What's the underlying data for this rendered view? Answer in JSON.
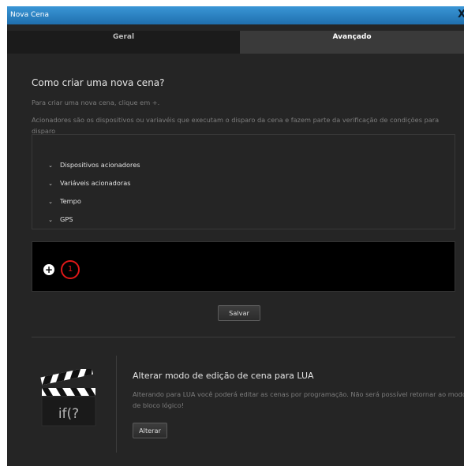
{
  "window": {
    "title": "Nova Cena",
    "close_label": "X"
  },
  "tabs": [
    {
      "label": "Geral",
      "active": false
    },
    {
      "label": "Avançado",
      "active": true
    }
  ],
  "intro": {
    "heading": "Como criar uma nova cena?",
    "line1": "Para criar uma nova cena, clique em +.",
    "line2": "Acionadores são os dispositivos ou variavéis que executam o disparo da cena e fazem parte da verificação de condições para disparo"
  },
  "triggers": [
    {
      "label": "Dispositivos acionadores"
    },
    {
      "label": "Variáveis acionadoras"
    },
    {
      "label": "Tempo"
    },
    {
      "label": "GPS"
    }
  ],
  "editor": {
    "add_symbol": "+",
    "badge_number": "1"
  },
  "save_button": "Salvar",
  "lua": {
    "heading": "Alterar modo de edição de cena para LUA",
    "description": "Alterando para LUA você poderá editar as cenas por programação. Não será possível retornar ao modo de bloco lógico!",
    "button": "Alterar",
    "icon_text": "if(?"
  },
  "colors": {
    "titlebar": "#2a84c6",
    "badge": "#e01818",
    "background": "#252525"
  }
}
